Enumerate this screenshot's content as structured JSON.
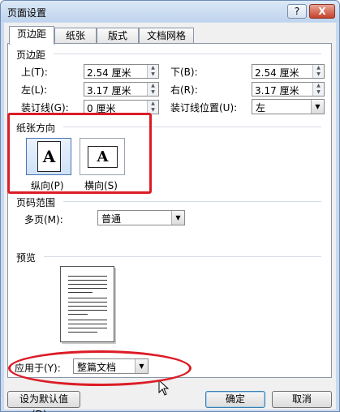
{
  "window": {
    "title": "页面设置",
    "help_label": "?",
    "close_label": "X"
  },
  "tabs": [
    {
      "label": "页边距",
      "active": true
    },
    {
      "label": "纸张",
      "active": false
    },
    {
      "label": "版式",
      "active": false
    },
    {
      "label": "文档网格",
      "active": false
    }
  ],
  "margins": {
    "group_title": "页边距",
    "top_label": "上(T):",
    "top_value": "2.54 厘米",
    "bottom_label": "下(B):",
    "bottom_value": "2.54 厘米",
    "left_label": "左(L):",
    "left_value": "3.17 厘米",
    "right_label": "右(R):",
    "right_value": "3.17 厘米",
    "gutter_label": "装订线(G):",
    "gutter_value": "0 厘米",
    "gutter_pos_label": "装订线位置(U):",
    "gutter_pos_value": "左"
  },
  "orientation": {
    "group_title": "纸张方向",
    "portrait_label": "纵向(P)",
    "landscape_label": "横向(S)",
    "icon_letter": "A",
    "selected": "portrait"
  },
  "pages": {
    "group_title": "页码范围",
    "multiple_label": "多页(M):",
    "multiple_value": "普通"
  },
  "preview": {
    "group_title": "预览",
    "apply_label": "应用于(Y):",
    "apply_value": "整篇文档"
  },
  "buttons": {
    "default_label": "设为默认值(D)...",
    "ok_label": "确定",
    "cancel_label": "取消"
  },
  "colors": {
    "highlight": "#dc1c26",
    "title_bar": "#c9daf0"
  }
}
